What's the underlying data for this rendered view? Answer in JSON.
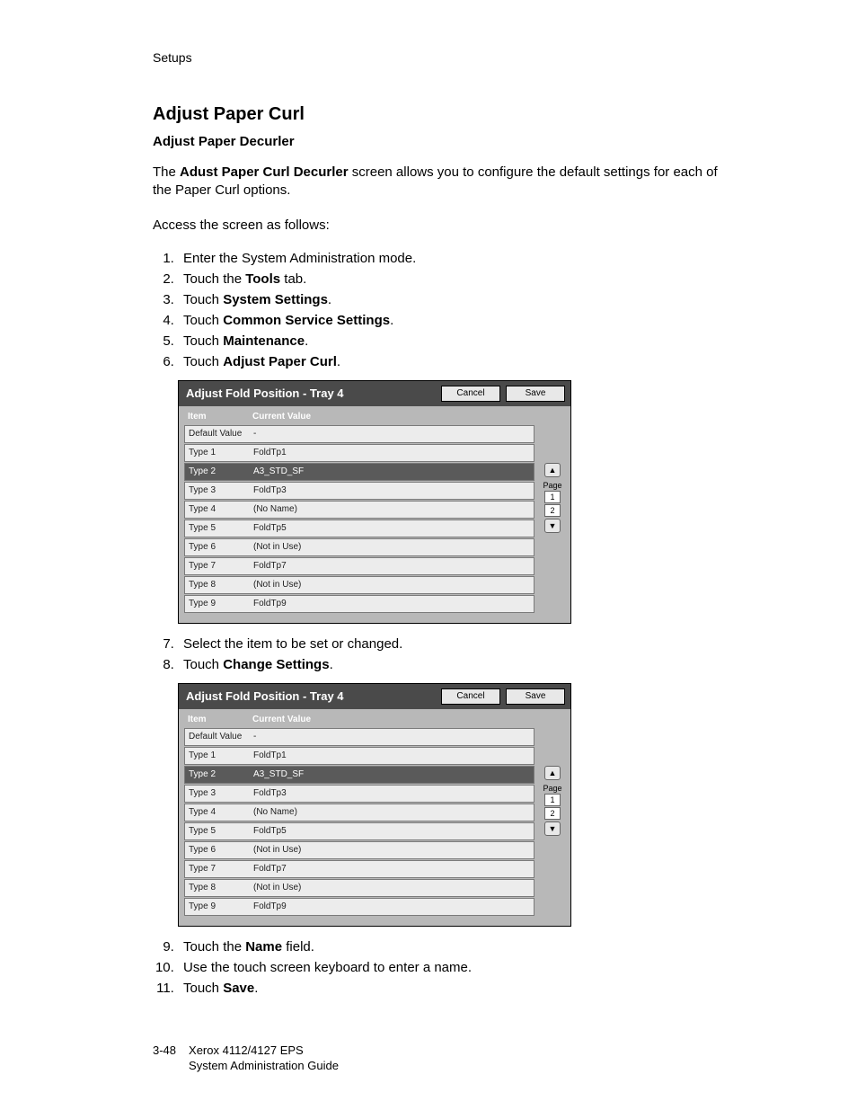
{
  "running_head": "Setups",
  "heading": "Adjust Paper Curl",
  "subheading": "Adjust Paper Decurler",
  "intro_pre": "The ",
  "intro_bold": "Adust Paper Curl Decurler",
  "intro_post": " screen allows you to configure the default settings for each of the Paper Curl options.",
  "access": "Access the screen as follows:",
  "steps_a": {
    "s1": "Enter the System Administration mode.",
    "s2a": "Touch the ",
    "s2b": "Tools",
    "s2c": " tab.",
    "s3a": "Touch ",
    "s3b": "System Settings",
    "s3c": ".",
    "s4a": "Touch ",
    "s4b": "Common Service Settings",
    "s4c": ".",
    "s5a": "Touch ",
    "s5b": "Maintenance",
    "s5c": ".",
    "s6a": "Touch ",
    "s6b": "Adjust Paper Curl",
    "s6c": "."
  },
  "steps_b": {
    "s7": "Select the item to be set or changed.",
    "s8a": "Touch ",
    "s8b": "Change Settings",
    "s8c": "."
  },
  "steps_c": {
    "s9a": "Touch the ",
    "s9b": "Name",
    "s9c": " field.",
    "s10": "Use the touch screen keyboard to enter a name.",
    "s11a": "Touch ",
    "s11b": "Save",
    "s11c": "."
  },
  "panel": {
    "title": "Adjust Fold Position - Tray 4",
    "cancel": "Cancel",
    "save": "Save",
    "col_item": "Item",
    "col_value": "Current Value",
    "page_label": "Page",
    "page1": "1",
    "page2": "2",
    "rows": [
      {
        "item": "Default Value",
        "value": "-"
      },
      {
        "item": "Type 1",
        "value": "FoldTp1"
      },
      {
        "item": "Type 2",
        "value": "A3_STD_SF"
      },
      {
        "item": "Type 3",
        "value": "FoldTp3"
      },
      {
        "item": "Type 4",
        "value": "(No Name)"
      },
      {
        "item": "Type 5",
        "value": "FoldTp5"
      },
      {
        "item": "Type 6",
        "value": "(Not in Use)"
      },
      {
        "item": "Type 7",
        "value": "FoldTp7"
      },
      {
        "item": "Type 8",
        "value": "(Not in Use)"
      },
      {
        "item": "Type 9",
        "value": "FoldTp9"
      }
    ]
  },
  "footer": {
    "page_num": "3-48",
    "line1": "Xerox 4112/4127 EPS",
    "line2": "System Administration Guide"
  }
}
